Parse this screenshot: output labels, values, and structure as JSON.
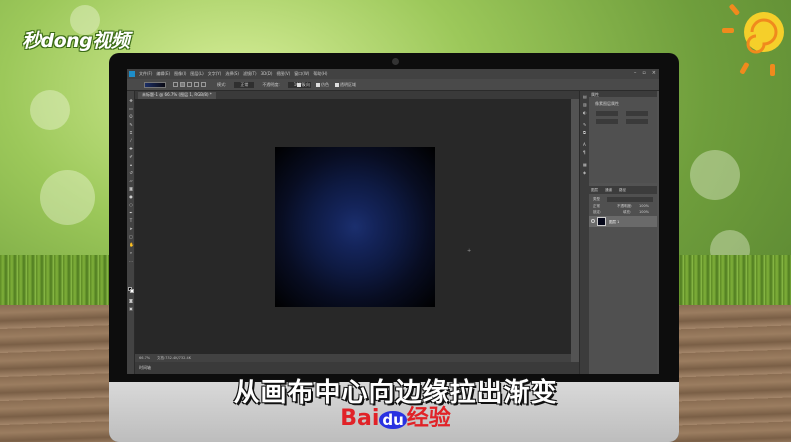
{
  "watermark": {
    "logo_text": "秒dong视频"
  },
  "photoshop": {
    "menu": [
      "文件(F)",
      "编辑(E)",
      "图像(I)",
      "图层(L)",
      "文字(Y)",
      "选择(S)",
      "滤镜(T)",
      "3D(D)",
      "视图(V)",
      "窗口(W)",
      "帮助(H)"
    ],
    "options": {
      "mode_label": "模式:",
      "mode_value": "正常",
      "opacity_label": "不透明度:",
      "opacity_value": "100%",
      "reverse_label": "反向",
      "dither_label": "仿色",
      "transparency_label": "透明区域"
    },
    "document_tab": "未标题-1 @ 66.7% (图层 1, RGB/8) *",
    "status": {
      "zoom": "66.7%",
      "doc": "文档:732.4K/732.4K"
    },
    "bottom_tab": "时间轴",
    "properties": {
      "title": "属性",
      "subtitle": "像素图层属性"
    },
    "layers": {
      "tabs": [
        "图层",
        "通道",
        "路径"
      ],
      "kind_label": "类型",
      "blend_mode": "正常",
      "opacity_label": "不透明度:",
      "opacity_value": "100%",
      "lock_label": "锁定:",
      "fill_label": "填充:",
      "fill_value": "100%",
      "layer_name": "图层 1"
    },
    "gradient_colors": {
      "center": "#1b2f6e",
      "edge": "#000000"
    }
  },
  "caption": "从画布中心向边缘拉出渐变",
  "brand": {
    "part1": "Bai",
    "part2": "du",
    "part3": "经验"
  }
}
